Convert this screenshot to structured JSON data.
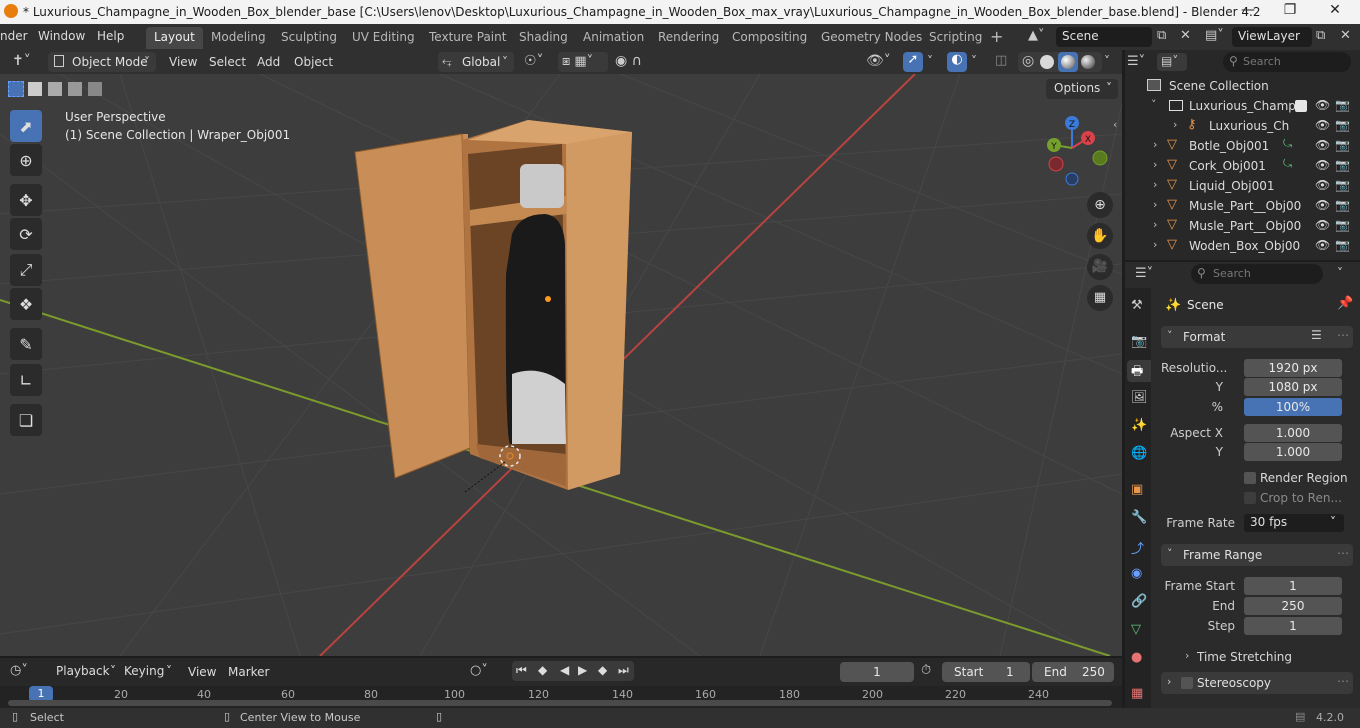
{
  "window": {
    "title": "* Luxurious_Champagne_in_Wooden_Box_blender_base [C:\\Users\\lenov\\Desktop\\Luxurious_Champagne_in_Wooden_Box_max_vray\\Luxurious_Champagne_in_Wooden_Box_blender_base.blend] - Blender 4.2"
  },
  "menu": {
    "items": [
      "nder",
      "Window",
      "Help"
    ]
  },
  "workspaces": [
    "Layout",
    "Modeling",
    "Sculpting",
    "UV Editing",
    "Texture Paint",
    "Shading",
    "Animation",
    "Rendering",
    "Compositing",
    "Geometry Nodes",
    "Scripting"
  ],
  "scene_field": "Scene",
  "viewlayer_field": "ViewLayer",
  "viewport_header": {
    "mode": "Object Mode",
    "menus": [
      "View",
      "Select",
      "Add",
      "Object"
    ],
    "orientation": "Global",
    "options": "Options"
  },
  "viewport": {
    "perspective": "User Perspective",
    "collection": "(1) Scene Collection | Wraper_Obj001"
  },
  "outliner": {
    "search_placeholder": "Search",
    "root": "Scene Collection",
    "items": [
      {
        "label": "Luxurious_Champa",
        "indent": 1
      },
      {
        "label": "Luxurious_Cha",
        "indent": 2
      },
      {
        "label": "Botle_Obj001",
        "indent": 1
      },
      {
        "label": "Cork_Obj001",
        "indent": 1
      },
      {
        "label": "Liquid_Obj001",
        "indent": 1
      },
      {
        "label": "Musle_Part__Obj00",
        "indent": 1
      },
      {
        "label": "Musle_Part__Obj00",
        "indent": 1
      },
      {
        "label": "Woden_Box_Obj00",
        "indent": 1
      }
    ]
  },
  "properties": {
    "search_placeholder": "Search",
    "context": "Scene",
    "format": {
      "header": "Format",
      "resolution_label": "Resolutio...",
      "res_x": "1920 px",
      "y_label": "Y",
      "res_y": "1080 px",
      "pct_label": "%",
      "res_pct": "100%",
      "aspect_label": "Aspect X",
      "aspect_x": "1.000",
      "aspect_y": "1.000",
      "render_region": "Render Region",
      "crop": "Crop to Ren...",
      "frame_rate_label": "Frame Rate",
      "frame_rate": "30 fps"
    },
    "frame_range": {
      "header": "Frame Range",
      "start_label": "Frame Start",
      "start": "1",
      "end_label": "End",
      "end": "250",
      "step_label": "Step",
      "step": "1",
      "time_stretching": "Time Stretching"
    },
    "stereoscopy": "Stereoscopy"
  },
  "timeline": {
    "menus": [
      "Playback",
      "Keying",
      "View",
      "Marker"
    ],
    "current_frame": "1",
    "start_label": "Start",
    "start": "1",
    "end_label": "End",
    "end": "250",
    "ticks": [
      "1",
      "20",
      "40",
      "60",
      "80",
      "100",
      "120",
      "140",
      "160",
      "180",
      "200",
      "220",
      "240"
    ]
  },
  "status": {
    "select": "Select",
    "center": "Center View to Mouse",
    "version": "4.2.0"
  },
  "colors": {
    "accent": "#4772b3",
    "grid_x_axis": "#b9433f",
    "grid_y_axis": "#7b9b2c",
    "wood": "#c98e57"
  }
}
